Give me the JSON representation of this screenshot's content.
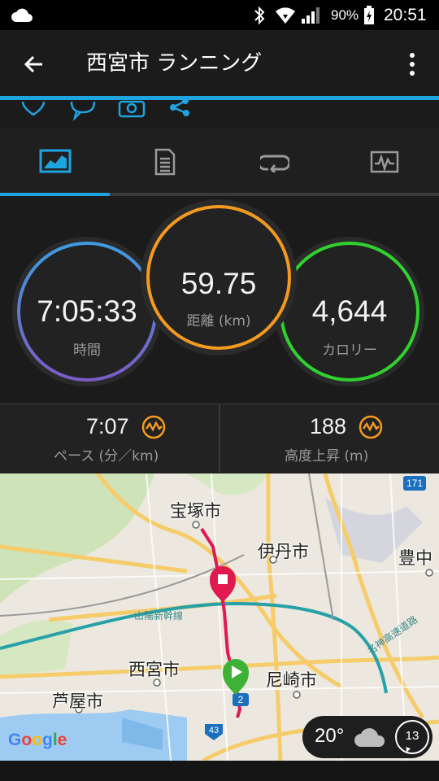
{
  "status_bar": {
    "battery_percent": "90%",
    "time": "20:51",
    "icons": [
      "cloud-icon",
      "bluetooth-icon",
      "wifi-icon",
      "signal-icon",
      "battery-charging-icon"
    ]
  },
  "app_bar": {
    "title": "西宮市 ランニング",
    "back_icon": "arrow-left-icon",
    "menu_icon": "more-vert-icon"
  },
  "action_icons": [
    "heart-icon",
    "comment-icon",
    "camera-icon",
    "share-icon"
  ],
  "tabs": [
    {
      "name": "overview",
      "icon": "overview-chart-icon",
      "active": true
    },
    {
      "name": "details",
      "icon": "document-icon",
      "active": false
    },
    {
      "name": "laps",
      "icon": "laps-icon",
      "active": false
    },
    {
      "name": "charts",
      "icon": "chart-icon",
      "active": false
    }
  ],
  "stats": {
    "time": {
      "value": "7:05:33",
      "label": "時間"
    },
    "distance": {
      "value": "59.75",
      "label": "距離 (km)"
    },
    "calories": {
      "value": "4,644",
      "label": "カロリー"
    }
  },
  "metrics": {
    "pace": {
      "value": "7:07",
      "label": "ペース (分／km)"
    },
    "elevation_gain": {
      "value": "188",
      "label": "高度上昇 (m)"
    }
  },
  "map": {
    "places": {
      "takarazuka": "宝塚市",
      "itami": "伊丹市",
      "toyonaka": "豊中",
      "nishinomiya": "西宮市",
      "amagasaki": "尼崎市",
      "ashiya": "芦屋市"
    },
    "line_labels": {
      "sanyo_shinkansen": "山陽新幹線",
      "meishin_expressway": "名神高速道路"
    },
    "road_badges": {
      "r171": "171",
      "r2": "2",
      "r43": "43"
    },
    "provider": "Google",
    "weather": {
      "temperature": "20°",
      "wind": "13",
      "icon": "cloudy-icon"
    }
  },
  "colors": {
    "accent_blue": "#1ea4df",
    "time_ring": "#3f8fd8",
    "distance_ring": "#f39a1f",
    "calorie_ring": "#2fd12f",
    "route": "#e0194e"
  }
}
